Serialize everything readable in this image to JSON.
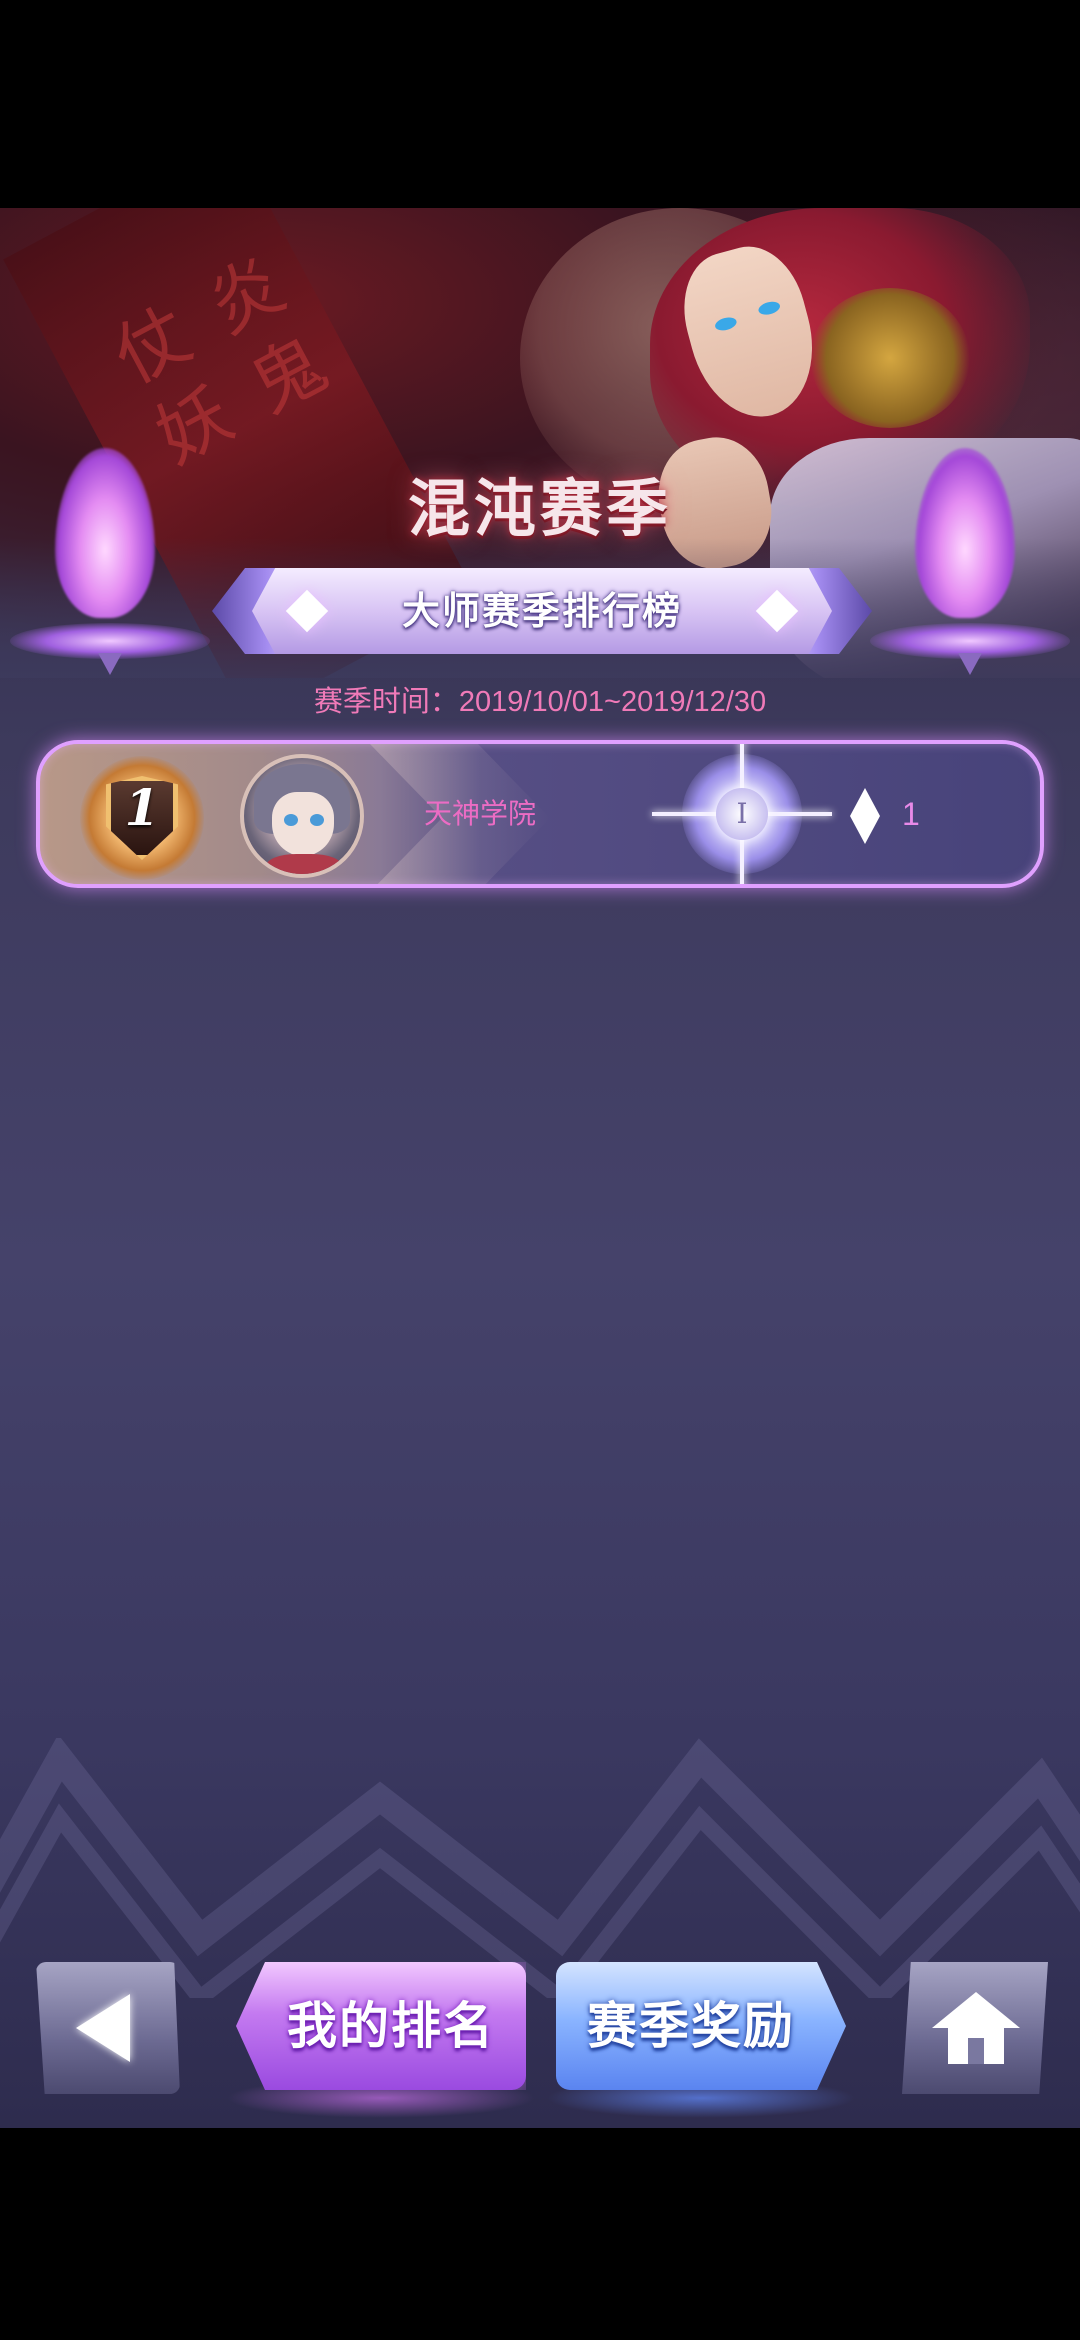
{
  "header": {
    "season_title": "混沌赛季",
    "leaderboard_title": "大师赛季排行榜",
    "season_time": "赛季时间：2019/10/01~2019/12/30"
  },
  "banner": {
    "scroll_glyphs": "仗 炎 妖 鬼"
  },
  "leaderboard": {
    "rows": [
      {
        "rank": "1",
        "guild_name": "天神学院",
        "tier_icon": "star-burst-emblem-icon",
        "tier_label": "I",
        "diamond_icon": "diamond-icon",
        "diamond_count": "1"
      }
    ]
  },
  "footer": {
    "back_icon": "back-arrow-icon",
    "my_rank_label": "我的排名",
    "season_reward_label": "赛季奖励",
    "home_icon": "home-icon"
  },
  "colors": {
    "background": "#45426a",
    "accent_pink": "#f07ab8",
    "row_border": "#e0a0ff",
    "button_purple": "#c47af0",
    "button_blue": "#8ab4ff"
  }
}
